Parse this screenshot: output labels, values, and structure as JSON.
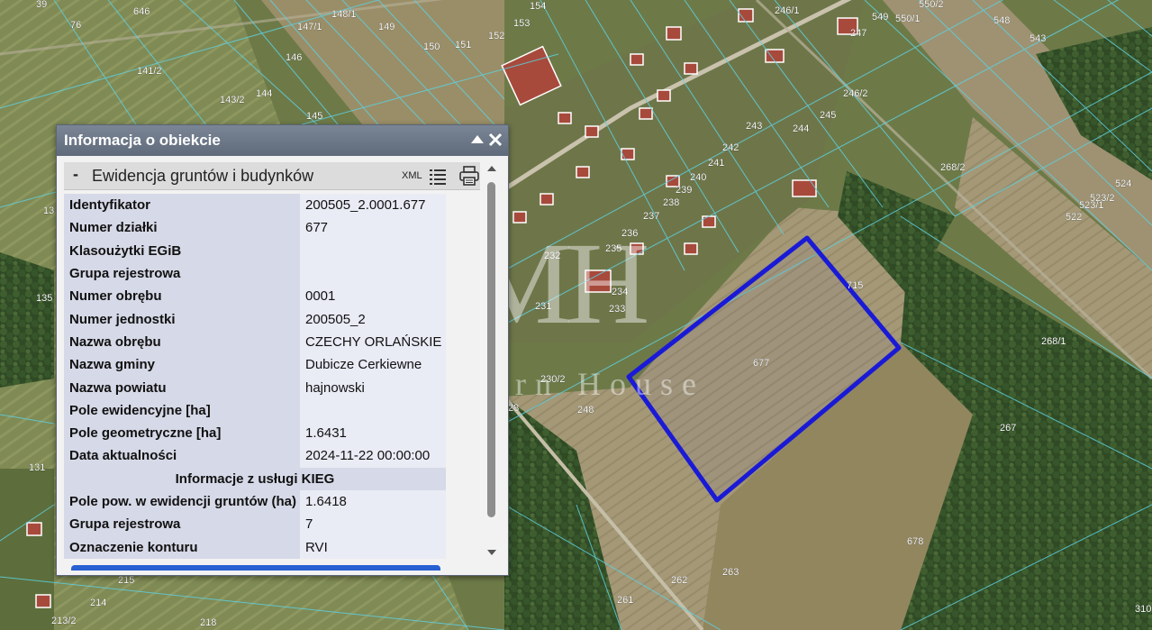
{
  "map": {
    "parcel_labels": [
      {
        "t": "39"
      },
      {
        "t": "646"
      },
      {
        "t": "76"
      },
      {
        "t": "148/1"
      },
      {
        "t": "147/1"
      },
      {
        "t": "149"
      },
      {
        "t": "154"
      },
      {
        "t": "153"
      },
      {
        "t": "152"
      },
      {
        "t": "151"
      },
      {
        "t": "150"
      },
      {
        "t": "146"
      },
      {
        "t": "141/2"
      },
      {
        "t": "143/2"
      },
      {
        "t": "144"
      },
      {
        "t": "145"
      },
      {
        "t": "13"
      },
      {
        "t": "135"
      },
      {
        "t": "131"
      },
      {
        "t": "215"
      },
      {
        "t": "214"
      },
      {
        "t": "213/2"
      },
      {
        "t": "218"
      },
      {
        "t": "246/1"
      },
      {
        "t": "549"
      },
      {
        "t": "550/1"
      },
      {
        "t": "550/2"
      },
      {
        "t": "548"
      },
      {
        "t": "543"
      },
      {
        "t": "247"
      },
      {
        "t": "246/2"
      },
      {
        "t": "245"
      },
      {
        "t": "244"
      },
      {
        "t": "243"
      },
      {
        "t": "242"
      },
      {
        "t": "241"
      },
      {
        "t": "240"
      },
      {
        "t": "239"
      },
      {
        "t": "238"
      },
      {
        "t": "237"
      },
      {
        "t": "236"
      },
      {
        "t": "235"
      },
      {
        "t": "234"
      },
      {
        "t": "233"
      },
      {
        "t": "232"
      },
      {
        "t": "231"
      },
      {
        "t": "268/2"
      },
      {
        "t": "524"
      },
      {
        "t": "523/2"
      },
      {
        "t": "523/1"
      },
      {
        "t": "522"
      },
      {
        "t": "715"
      },
      {
        "t": "268/1"
      },
      {
        "t": "677"
      },
      {
        "t": "230/2"
      },
      {
        "t": "28"
      },
      {
        "t": "248"
      },
      {
        "t": "267"
      },
      {
        "t": "678"
      },
      {
        "t": "262"
      },
      {
        "t": "263"
      },
      {
        "t": "261"
      },
      {
        "t": "310"
      }
    ],
    "watermark_line1": "MH",
    "watermark_line2": "Modern House",
    "highlight_color": "#1a1ad6"
  },
  "panel": {
    "title": "Informacja o obiekcie",
    "minimize_icon": "triangle-up-icon",
    "close_icon": "close-icon",
    "section": {
      "toggle": "-",
      "title": "Ewidencja gruntów i budynków",
      "xml_label": "XML",
      "list_icon": "list-icon",
      "print_icon": "printer-icon"
    },
    "rows": [
      {
        "key": "Identyfikator",
        "value": "200505_2.0001.677"
      },
      {
        "key": "Numer działki",
        "value": "677"
      },
      {
        "key": "Klasoużytki EGiB",
        "value": ""
      },
      {
        "key": "Grupa rejestrowa",
        "value": ""
      },
      {
        "key": "Numer obrębu",
        "value": "0001"
      },
      {
        "key": "Numer jednostki",
        "value": "200505_2"
      },
      {
        "key": "Nazwa obrębu",
        "value": "CZECHY ORLAŃSKIE"
      },
      {
        "key": "Nazwa gminy",
        "value": "Dubicze Cerkiewne"
      },
      {
        "key": "Nazwa powiatu",
        "value": "hajnowski"
      },
      {
        "key": "Pole ewidencyjne [ha]",
        "value": ""
      },
      {
        "key": "Pole geometryczne [ha]",
        "value": "1.6431"
      },
      {
        "key": "Data aktualności",
        "value": "2024-11-22 00:00:00"
      }
    ],
    "subheader": "Informacje z usługi KIEG",
    "kieg_rows": [
      {
        "key": "Pole pow. w ewidencji gruntów (ha)",
        "value": "1.6418"
      },
      {
        "key": "Grupa rejestrowa",
        "value": "7"
      },
      {
        "key": "Oznaczenie konturu",
        "value": "RVI"
      }
    ]
  }
}
